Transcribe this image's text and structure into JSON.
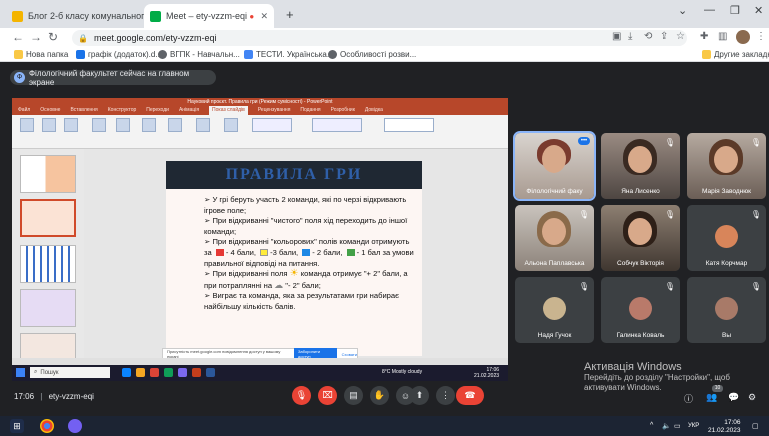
{
  "browser": {
    "tabs": [
      {
        "title": "Блог 2-б класу комунального з",
        "active": false,
        "icon_color": "#f4b400"
      },
      {
        "title": "Meet – ety-vzzm-eqi",
        "active": true,
        "icon_color": "#00ac47"
      }
    ],
    "new_tab": "+",
    "url": "meet.google.com/ety-vzzm-eqi",
    "bookmarks": [
      "Нова папка",
      "графік (додаток).d...",
      "ВГПК - Навчальн...",
      "ТЕСТИ. Українська...",
      "Особливості розви..."
    ],
    "bookmarks_other": "Другие закладки"
  },
  "meet": {
    "presenting_banner": "Філологічний факультет сейчас на главном экране",
    "presenter_initial": "Ф",
    "meeting_code": "ety-vzzm-eqi",
    "time": "17:06",
    "participant_count": "10",
    "participants": [
      {
        "name": "Філологічний факу"
      },
      {
        "name": "Яна Лисенко"
      },
      {
        "name": "Марія Заводнюк"
      },
      {
        "name": "Альона Паплавська"
      },
      {
        "name": "Собчук Вікторія"
      },
      {
        "name": "Катя Корчмар"
      },
      {
        "name": "Надя Гучок"
      },
      {
        "name": "Галинка Коваль"
      },
      {
        "name": "Вы"
      }
    ]
  },
  "slide": {
    "title": "ПРАВИЛА ГРИ",
    "l1": "➢ У грі беруть участь 2 команди, які по черзі відкривають ігрове поле;",
    "l2": "➢ При відкриванні \"чистого\" поля хід переходить до іншої команди;",
    "l3": "➢ При відкриванні \"кольорових\" полів команди отримують за",
    "l3b": "- 4 бали,",
    "l3c": "-3 бали,",
    "l3d": "- 2 бали,",
    "l3e": "- 1 бал за умови правильної відповіді на питання.",
    "l4": "➢ При відкриванні поля",
    "l4b": "команда отримує \"+ 2\" бали, а при потраплянні на",
    "l4c": "\"- 2\" бали;",
    "l5": "➢ Виграє та команда, яка за результатами гри набирає найбільшу кількість балів."
  },
  "powerpoint": {
    "window_title": "Науковий проєкт. Правила гри (Режим сумісності) - PowerPoint",
    "tabs": [
      "Файл",
      "Основне",
      "Вставлення",
      "Конструктор",
      "Переходи",
      "Анімація",
      "Показ слайдів",
      "Рецензування",
      "Подання",
      "Розробник",
      "Довідка"
    ],
    "selected_tab": "Показ слайдів",
    "notification": "Присутність meet.google.com повідомлення доступ у вашому екрані",
    "notif_btn1": "Заборонити доступ",
    "notif_btn2": "Сховати",
    "search_placeholder": "Пошук",
    "weather": "8°C Mostly cloudy",
    "clock_time": "17:06",
    "clock_date": "21.02.2023"
  },
  "windows": {
    "activate_title": "Активація Windows",
    "activate_line1": "Перейдіть до розділу \"Настройки\", щоб",
    "activate_line2": "активувати Windows.",
    "lang": "УКР",
    "time": "17:06",
    "date": "21.02.2023"
  },
  "colors": {
    "red_cell": "#e53935",
    "yellow_cell": "#ffeb3b",
    "blue_cell": "#1e88e5",
    "green_cell": "#43a047",
    "meet_bg": "#202124",
    "end_call": "#ea4335"
  }
}
